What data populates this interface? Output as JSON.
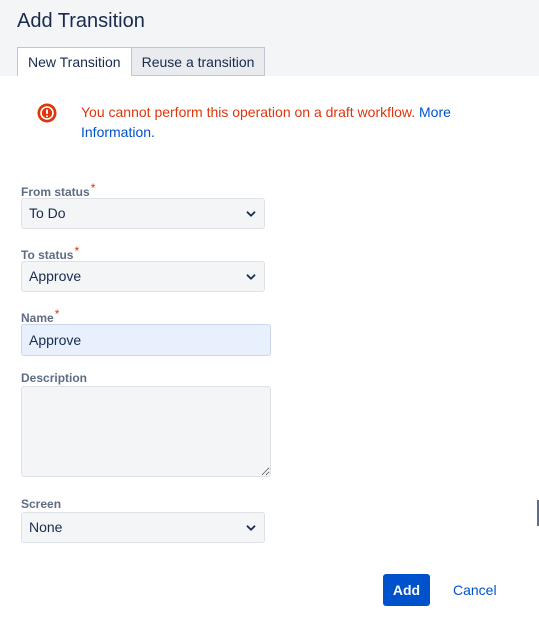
{
  "dialog": {
    "title": "Add Transition"
  },
  "tabs": [
    {
      "label": "New Transition",
      "active": true
    },
    {
      "label": "Reuse a transition",
      "active": false
    }
  ],
  "error": {
    "icon": "error-circle-icon",
    "message": "You cannot perform this operation on a draft workflow.",
    "link_text": "More Information."
  },
  "form": {
    "required_marker": "*",
    "from_status": {
      "label": "From status",
      "value": "To Do"
    },
    "to_status": {
      "label": "To status",
      "value": "Approve"
    },
    "name": {
      "label": "Name",
      "value": "Approve"
    },
    "description": {
      "label": "Description",
      "value": ""
    },
    "screen": {
      "label": "Screen",
      "value": "None"
    }
  },
  "actions": {
    "add_label": "Add",
    "cancel_label": "Cancel"
  },
  "colors": {
    "primary": "#0052cc",
    "error": "#de350b",
    "header_bg": "#f4f5f7",
    "field_bg": "#f4f5f7",
    "autofill_bg": "#e8f0fe"
  }
}
